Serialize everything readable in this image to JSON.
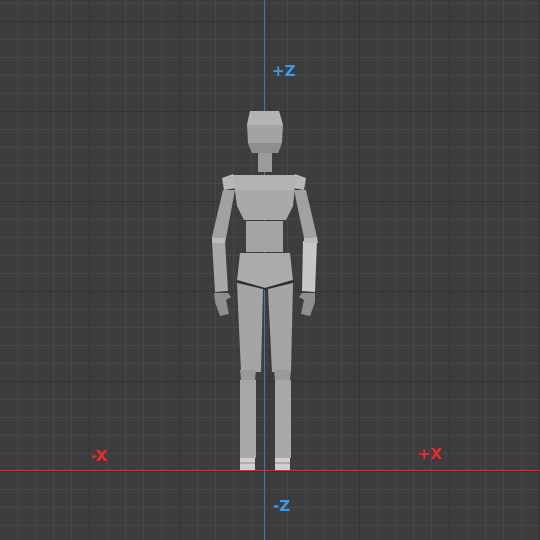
{
  "viewport": {
    "background_color": "#3d3d3d",
    "grid_minor_color": "#474747",
    "grid_major_color": "#333333"
  },
  "axes": {
    "z_axis_color": "#3a78c8",
    "x_axis_color": "#b4403f",
    "labels": {
      "pos_z": "+Z",
      "neg_z": "-Z",
      "neg_x": "-X",
      "pos_x": "+X"
    },
    "label_colors": {
      "z": "#3a9cf0",
      "x": "#ee2a2a"
    }
  },
  "model": {
    "name": "mannequin-figure",
    "body_color": "#a6a6a6",
    "light_color": "#c8c8c8",
    "shadow_color": "#7e7e7e"
  }
}
